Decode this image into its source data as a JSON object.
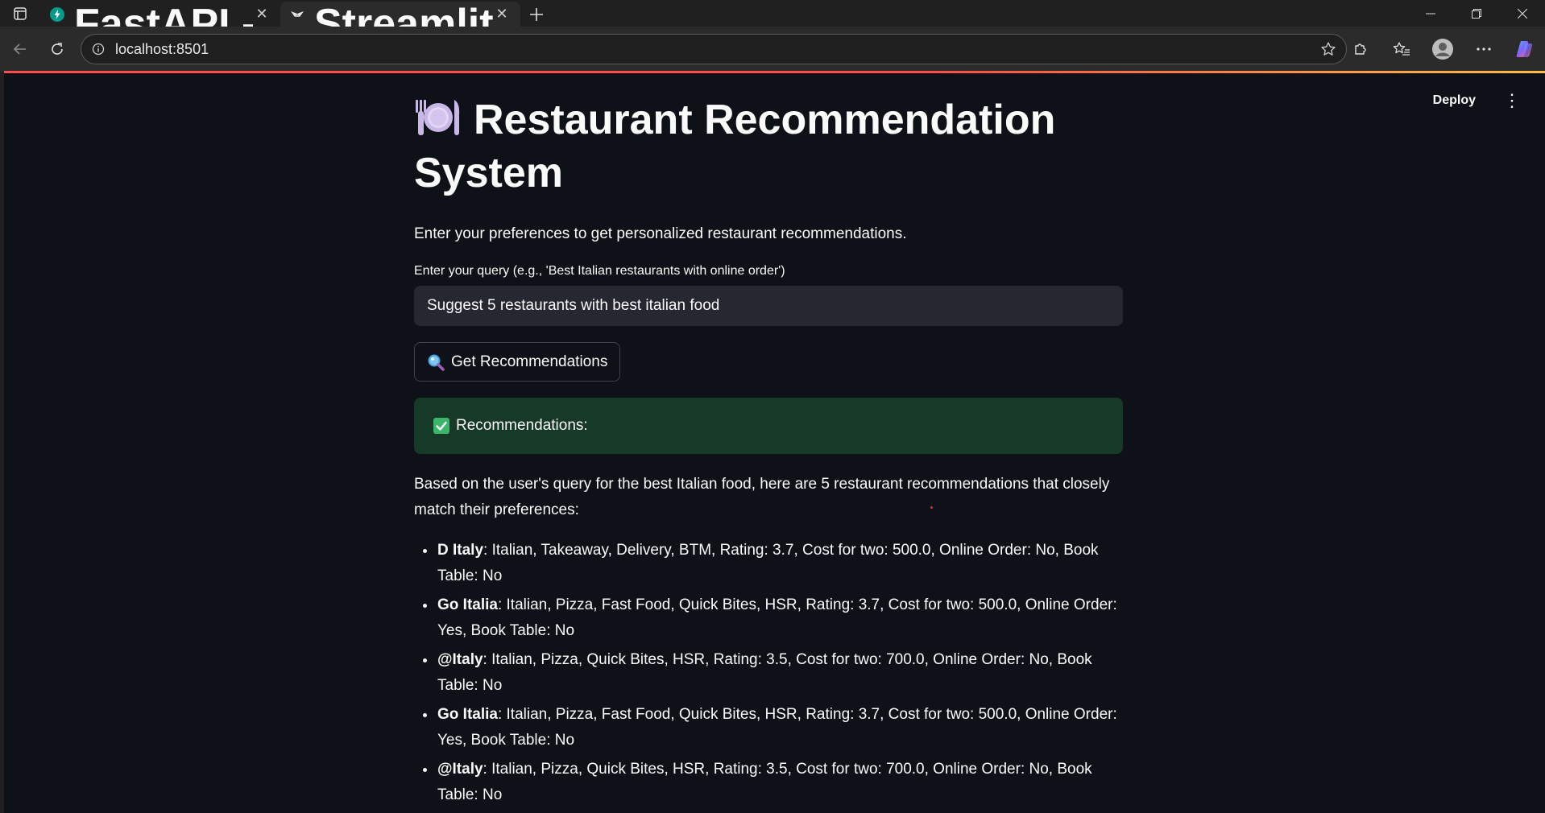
{
  "browser": {
    "tabs": [
      {
        "title": "FastAPI - Swagger UI",
        "active": false,
        "favicon": "fastapi-icon"
      },
      {
        "title": "Streamlit",
        "active": true,
        "favicon": "streamlit-icon"
      }
    ],
    "url": "localhost:8501"
  },
  "app": {
    "header": {
      "deploy_label": "Deploy"
    },
    "title": "Restaurant Recommendation System",
    "title_icon": "plate-cutlery-icon",
    "intro": "Enter your preferences to get personalized restaurant recommendations.",
    "query": {
      "label": "Enter your query (e.g., 'Best Italian restaurants with online order')",
      "value": "Suggest 5 restaurants with best italian food"
    },
    "button_label": "Get Recommendations",
    "success_label": "Recommendations:",
    "response_intro": "Based on the user's query for the best Italian food, here are 5 restaurant recommendations that closely match their preferences:",
    "recommendations": [
      {
        "name": "D Italy",
        "details": ": Italian, Takeaway, Delivery, BTM, Rating: 3.7, Cost for two: 500.0, Online Order: No, Book Table: No"
      },
      {
        "name": "Go Italia",
        "details": ": Italian, Pizza, Fast Food, Quick Bites, HSR, Rating: 3.7, Cost for two: 500.0, Online Order: Yes, Book Table: No"
      },
      {
        "name": "@Italy",
        "details": ": Italian, Pizza, Quick Bites, HSR, Rating: 3.5, Cost for two: 700.0, Online Order: No, Book Table: No"
      },
      {
        "name": "Go Italia",
        "details": ": Italian, Pizza, Fast Food, Quick Bites, HSR, Rating: 3.7, Cost for two: 500.0, Online Order: Yes, Book Table: No"
      },
      {
        "name": "@Italy",
        "details": ": Italian, Pizza, Quick Bites, HSR, Rating: 3.5, Cost for two: 700.0, Online Order: No, Book Table: No"
      }
    ]
  },
  "colors": {
    "app_background": "#0e1117",
    "input_background": "#262730",
    "success_background": "#173928",
    "accent": "#ff4b4b"
  }
}
